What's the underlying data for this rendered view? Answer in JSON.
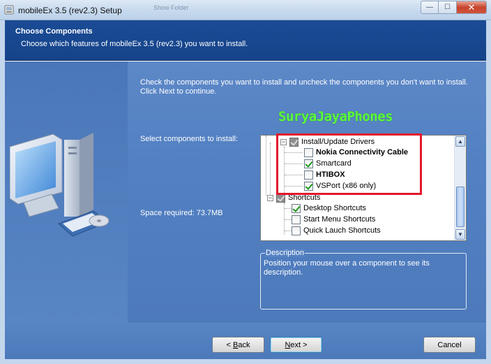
{
  "window": {
    "title": "mobileEx 3.5 (rev2.3) Setup",
    "ghost_text": "Show Folder",
    "caption_minimize": "—",
    "caption_maximize": "☐",
    "caption_close": "✕"
  },
  "header": {
    "title": "Choose Components",
    "subtitle": "Choose which features of mobileEx 3.5 (rev2.3) you want to install."
  },
  "instructions": "Check the components you want to install and uncheck the components you don't want to install. Click Next to continue.",
  "watermark": "SuryaJayaPhones",
  "select_label": "Select components to install:",
  "space_required": "Space required: 73.7MB",
  "tree": {
    "drivers_group": {
      "label": "Install/Update Drivers",
      "state": "partial"
    },
    "drivers": [
      {
        "label": "Nokia Connectivity Cable",
        "checked": false,
        "bold": true
      },
      {
        "label": "Smartcard",
        "checked": true,
        "bold": false
      },
      {
        "label": "HTIBOX",
        "checked": false,
        "bold": true
      },
      {
        "label": "VSPort (x86 only)",
        "checked": true,
        "bold": false
      }
    ],
    "shortcuts_group": {
      "label": "Shortcuts",
      "state": "partial"
    },
    "shortcuts": [
      {
        "label": "Desktop Shortcuts",
        "checked": true
      },
      {
        "label": "Start Menu Shortcuts",
        "checked": false
      },
      {
        "label": "Quick Lauch Shortcuts",
        "checked": false
      }
    ],
    "scroll_up": "▲",
    "scroll_down": "▼"
  },
  "description": {
    "legend": "Description",
    "text": "Position your mouse over a component to see its description."
  },
  "buttons": {
    "back_prefix": "< ",
    "back_key": "B",
    "back_rest": "ack",
    "next_key": "N",
    "next_rest": "ext >",
    "cancel": "Cancel"
  },
  "colors": {
    "header_bg": "#16448a",
    "panel_bg": "#5280c2",
    "highlight_box": "#e3172b",
    "watermark": "#5cff3b"
  }
}
